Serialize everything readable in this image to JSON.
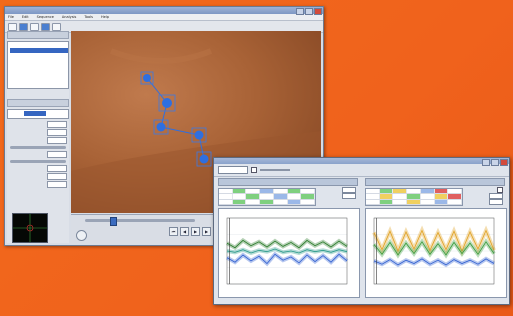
{
  "main_window": {
    "title": "",
    "menu": [
      "File",
      "Edit",
      "Sequence",
      "Analysis",
      "Tools",
      "Help"
    ],
    "toolbar_buttons": 5,
    "left_panel": {
      "section1_label": "",
      "section2_label": "",
      "field_labels": [
        "",
        "",
        "",
        "",
        "",
        "",
        ""
      ]
    }
  },
  "analysis_window": {
    "title": "",
    "left_side_label": "",
    "right_side_label": "",
    "left_plot_title": "",
    "right_plot_title": ""
  },
  "colors": {
    "background": "#f26a1b",
    "highlight": "#3566c1",
    "marker": "#2f6fe0"
  },
  "chart_data": [
    {
      "type": "line",
      "series": [
        {
          "values": [
            0.62,
            0.55,
            0.66,
            0.58,
            0.64,
            0.56,
            0.65,
            0.57,
            0.63,
            0.55,
            0.66,
            0.58,
            0.64,
            0.56,
            0.65,
            0.57
          ]
        },
        {
          "values": [
            0.4,
            0.33,
            0.44,
            0.35,
            0.42,
            0.31,
            0.45,
            0.36,
            0.41,
            0.32,
            0.44,
            0.34,
            0.43,
            0.33,
            0.45,
            0.35
          ]
        },
        {
          "values": [
            0.5,
            0.48,
            0.52,
            0.47,
            0.51,
            0.49,
            0.53,
            0.48,
            0.5,
            0.47,
            0.52,
            0.49,
            0.51,
            0.48,
            0.52,
            0.49
          ]
        }
      ],
      "ylim": [
        0,
        1
      ]
    },
    {
      "type": "line",
      "series": [
        {
          "values": [
            0.78,
            0.52,
            0.8,
            0.5,
            0.79,
            0.53,
            0.81,
            0.51,
            0.78,
            0.52,
            0.8,
            0.5,
            0.79,
            0.53,
            0.81,
            0.51
          ]
        },
        {
          "values": [
            0.6,
            0.45,
            0.63,
            0.44,
            0.62,
            0.46,
            0.64,
            0.45,
            0.61,
            0.44,
            0.63,
            0.46,
            0.62,
            0.45,
            0.64,
            0.46
          ]
        },
        {
          "values": [
            0.35,
            0.3,
            0.37,
            0.29,
            0.36,
            0.31,
            0.38,
            0.3,
            0.36,
            0.29,
            0.37,
            0.31,
            0.36,
            0.3,
            0.38,
            0.31
          ]
        }
      ],
      "ylim": [
        0,
        1
      ]
    }
  ]
}
